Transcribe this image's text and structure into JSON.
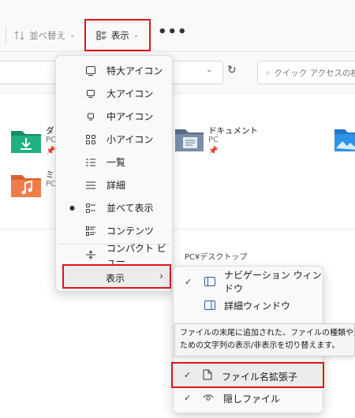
{
  "toolbar": {
    "sort_label": "並べ替え",
    "view_label": "表示",
    "more_label": "•••"
  },
  "search": {
    "placeholder": "クイック アクセスの検"
  },
  "folders": [
    {
      "name": "ダ",
      "sub": "PC",
      "color": "#1fa37a"
    },
    {
      "name": "ドキュメント",
      "sub": "PC",
      "color": "#6b7f9c"
    },
    {
      "name": "ミ",
      "sub": "PC",
      "color": "#f08a4b"
    }
  ],
  "content": {
    "pc_label": "PC¥デスクトップ"
  },
  "view_menu": {
    "items": [
      {
        "label": "特大アイコン",
        "icon": "monitor-icon"
      },
      {
        "label": "大アイコン",
        "icon": "monitor-icon"
      },
      {
        "label": "中アイコン",
        "icon": "monitor-small-icon"
      },
      {
        "label": "小アイコン",
        "icon": "grid-icon"
      },
      {
        "label": "一覧",
        "icon": "list-icon"
      },
      {
        "label": "詳細",
        "icon": "details-icon"
      },
      {
        "label": "並べて表示",
        "icon": "tiles-icon",
        "selected": true
      },
      {
        "label": "コンテンツ",
        "icon": "content-icon"
      }
    ],
    "compact_label": "コンパクト ビュー",
    "show_label": "表示"
  },
  "show_submenu": {
    "items": [
      {
        "label": "ナビゲーション ウィンドウ",
        "checked": true,
        "icon": "nav-pane-icon"
      },
      {
        "label": "詳細ウィンドウ",
        "checked": false,
        "icon": "details-pane-icon"
      },
      {
        "label": "ファイル名拡張子",
        "checked": true,
        "icon": "file-icon"
      },
      {
        "label": "隠しファイル",
        "checked": true,
        "icon": "eye-icon"
      }
    ]
  },
  "tooltip": {
    "line1": "ファイルの末尾に追加された、ファイルの種類や形式を",
    "line2": "ための文字列の表示/非表示を切り替えます。"
  },
  "colors": {
    "highlight": "#e0141e",
    "menu_bg": "#f9f9f9"
  }
}
